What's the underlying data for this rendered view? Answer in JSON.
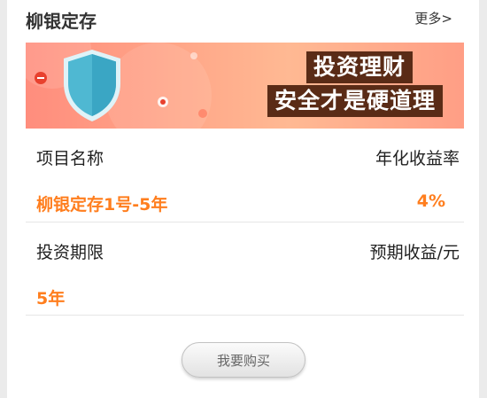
{
  "header": {
    "title": "柳银定存",
    "more_label": "更多>"
  },
  "banner": {
    "line1": "投资理财",
    "line2": "安全才是硬道理"
  },
  "rows": {
    "project_name_label": "项目名称",
    "annual_rate_label": "年化收益率",
    "project_name_value": "柳银定存1号-5年",
    "annual_rate_value": "4%",
    "term_label": "投资期限",
    "expected_income_label": "预期收益/元",
    "term_value": "5年"
  },
  "buy_button_label": "我要购买",
  "colors": {
    "accent": "#ff7e1e",
    "banner_text_bg": "#5a2b16",
    "shield": "#4fb8d2"
  },
  "icons": {
    "shield": "shield-icon"
  }
}
